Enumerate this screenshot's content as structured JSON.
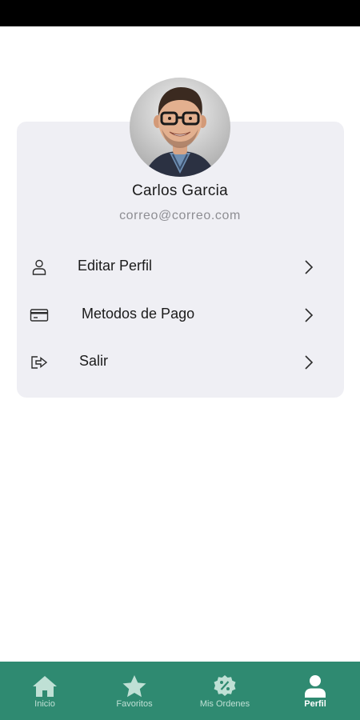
{
  "profile": {
    "name": "Carlos Garcia",
    "email": "correo@correo.com"
  },
  "menu": [
    {
      "label": "Editar Perfil",
      "icon": "user-icon"
    },
    {
      "label": "Metodos de Pago",
      "icon": "credit-card-icon"
    },
    {
      "label": "Salir",
      "icon": "logout-icon"
    }
  ],
  "bottom_nav": {
    "active": "Perfil",
    "items": [
      {
        "label": "Inicio",
        "icon": "home-icon"
      },
      {
        "label": "Favoritos",
        "icon": "star-icon"
      },
      {
        "label": "Mis Ordenes",
        "icon": "discount-badge-icon"
      },
      {
        "label": "Perfil",
        "icon": "person-icon"
      }
    ]
  },
  "colors": {
    "accent": "#2f8a71",
    "card_background": "#efeff4",
    "email_text": "#8e8e93"
  }
}
